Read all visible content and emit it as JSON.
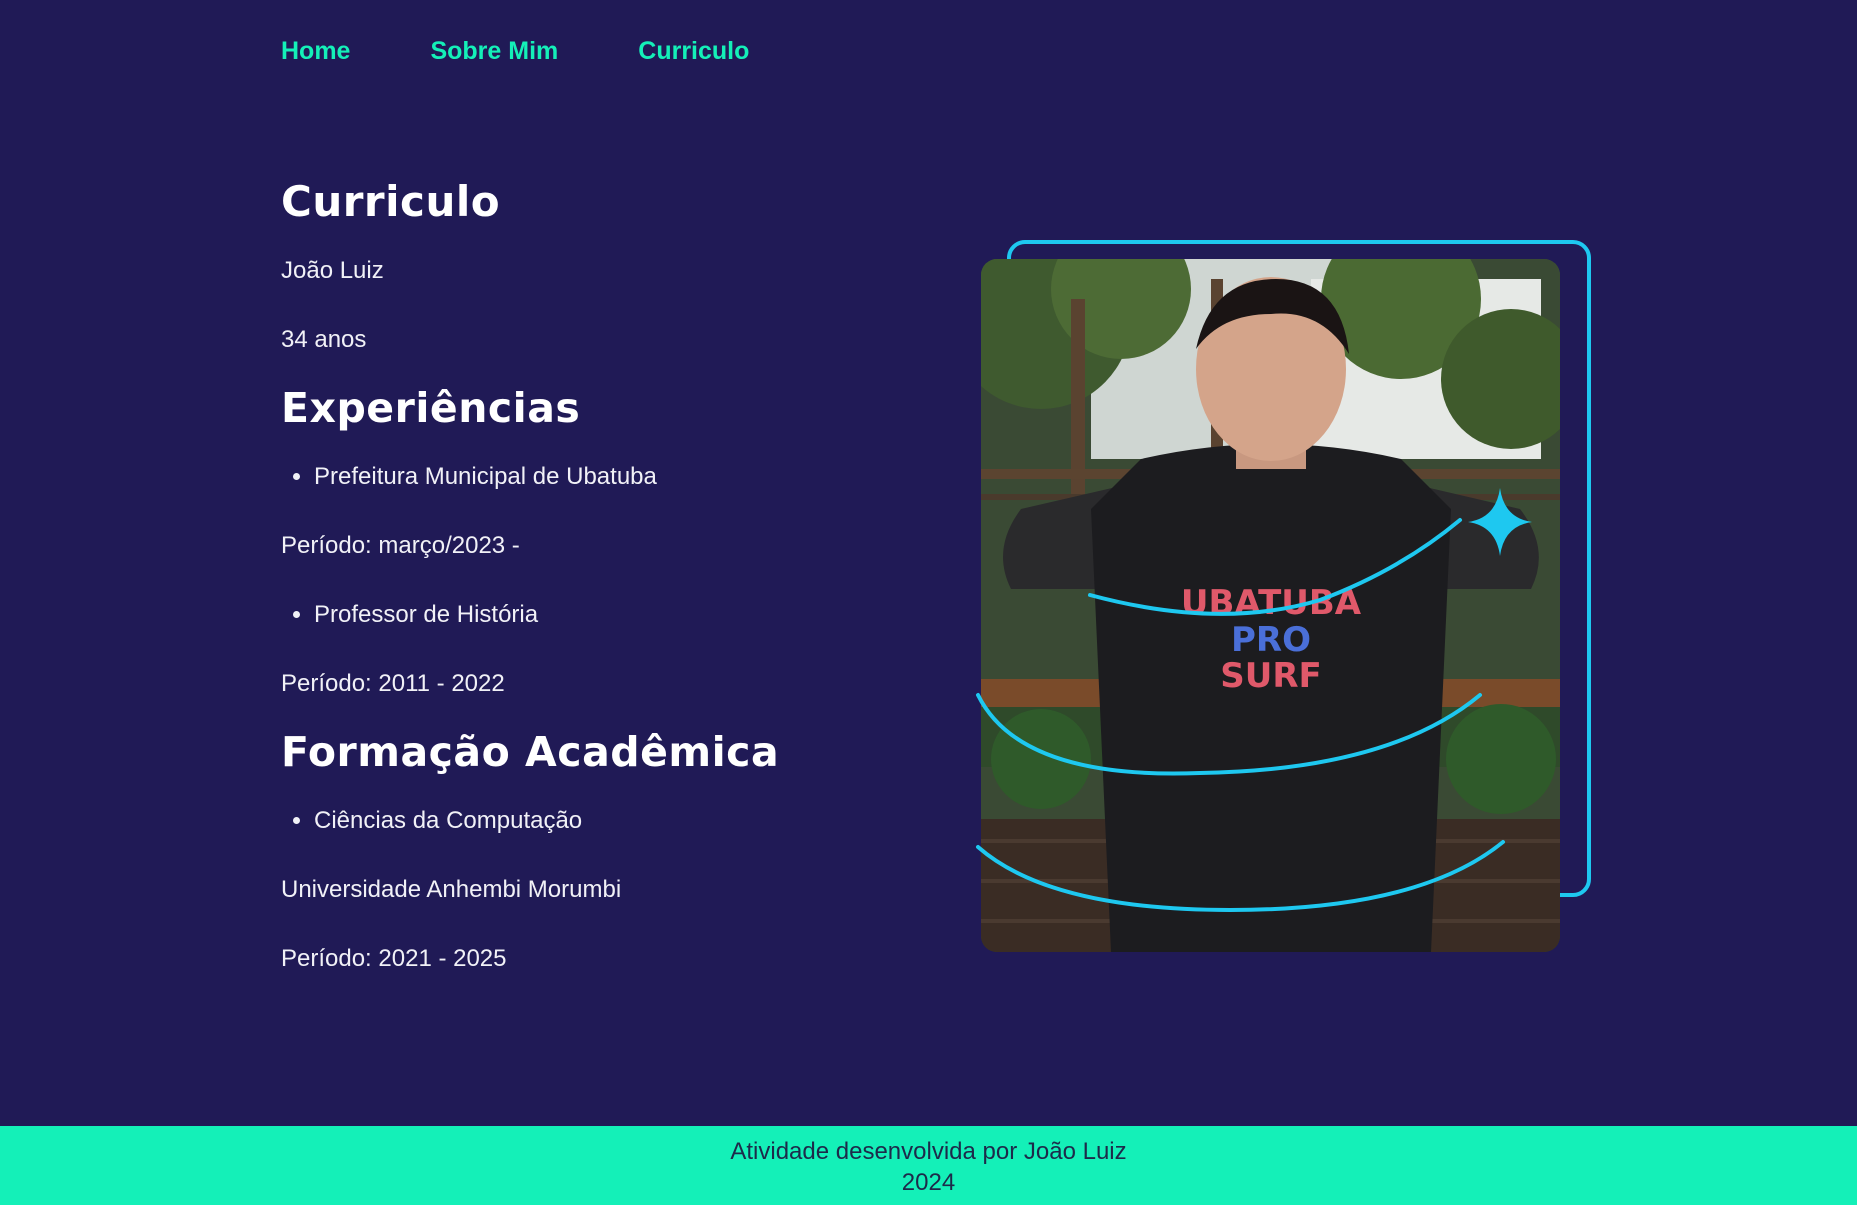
{
  "nav": {
    "items": [
      {
        "label": "Home"
      },
      {
        "label": "Sobre Mim"
      },
      {
        "label": "Curriculo"
      }
    ]
  },
  "main": {
    "title": "Curriculo",
    "name": "João Luiz",
    "age": "34 anos",
    "experiences": {
      "heading": "Experiências",
      "items": [
        {
          "role": "Prefeitura Municipal de Ubatuba",
          "period": "Período: março/2023 -"
        },
        {
          "role": "Professor de História",
          "period": "Período: 2011 - 2022"
        }
      ]
    },
    "education": {
      "heading": "Formação Acadêmica",
      "items": [
        {
          "course": "Ciências da Computação",
          "institution": "Universidade Anhembi Morumbi",
          "period": "Período: 2021 - 2025"
        }
      ]
    }
  },
  "photo": {
    "shirt_text": [
      "UBATUBA",
      "PRO",
      "SURF"
    ]
  },
  "footer": {
    "line1": "Atividade desenvolvida por João Luiz",
    "line2": "2024"
  },
  "colors": {
    "background": "#201a56",
    "accent": "#14f0b8",
    "frame": "#1ec8f0"
  }
}
